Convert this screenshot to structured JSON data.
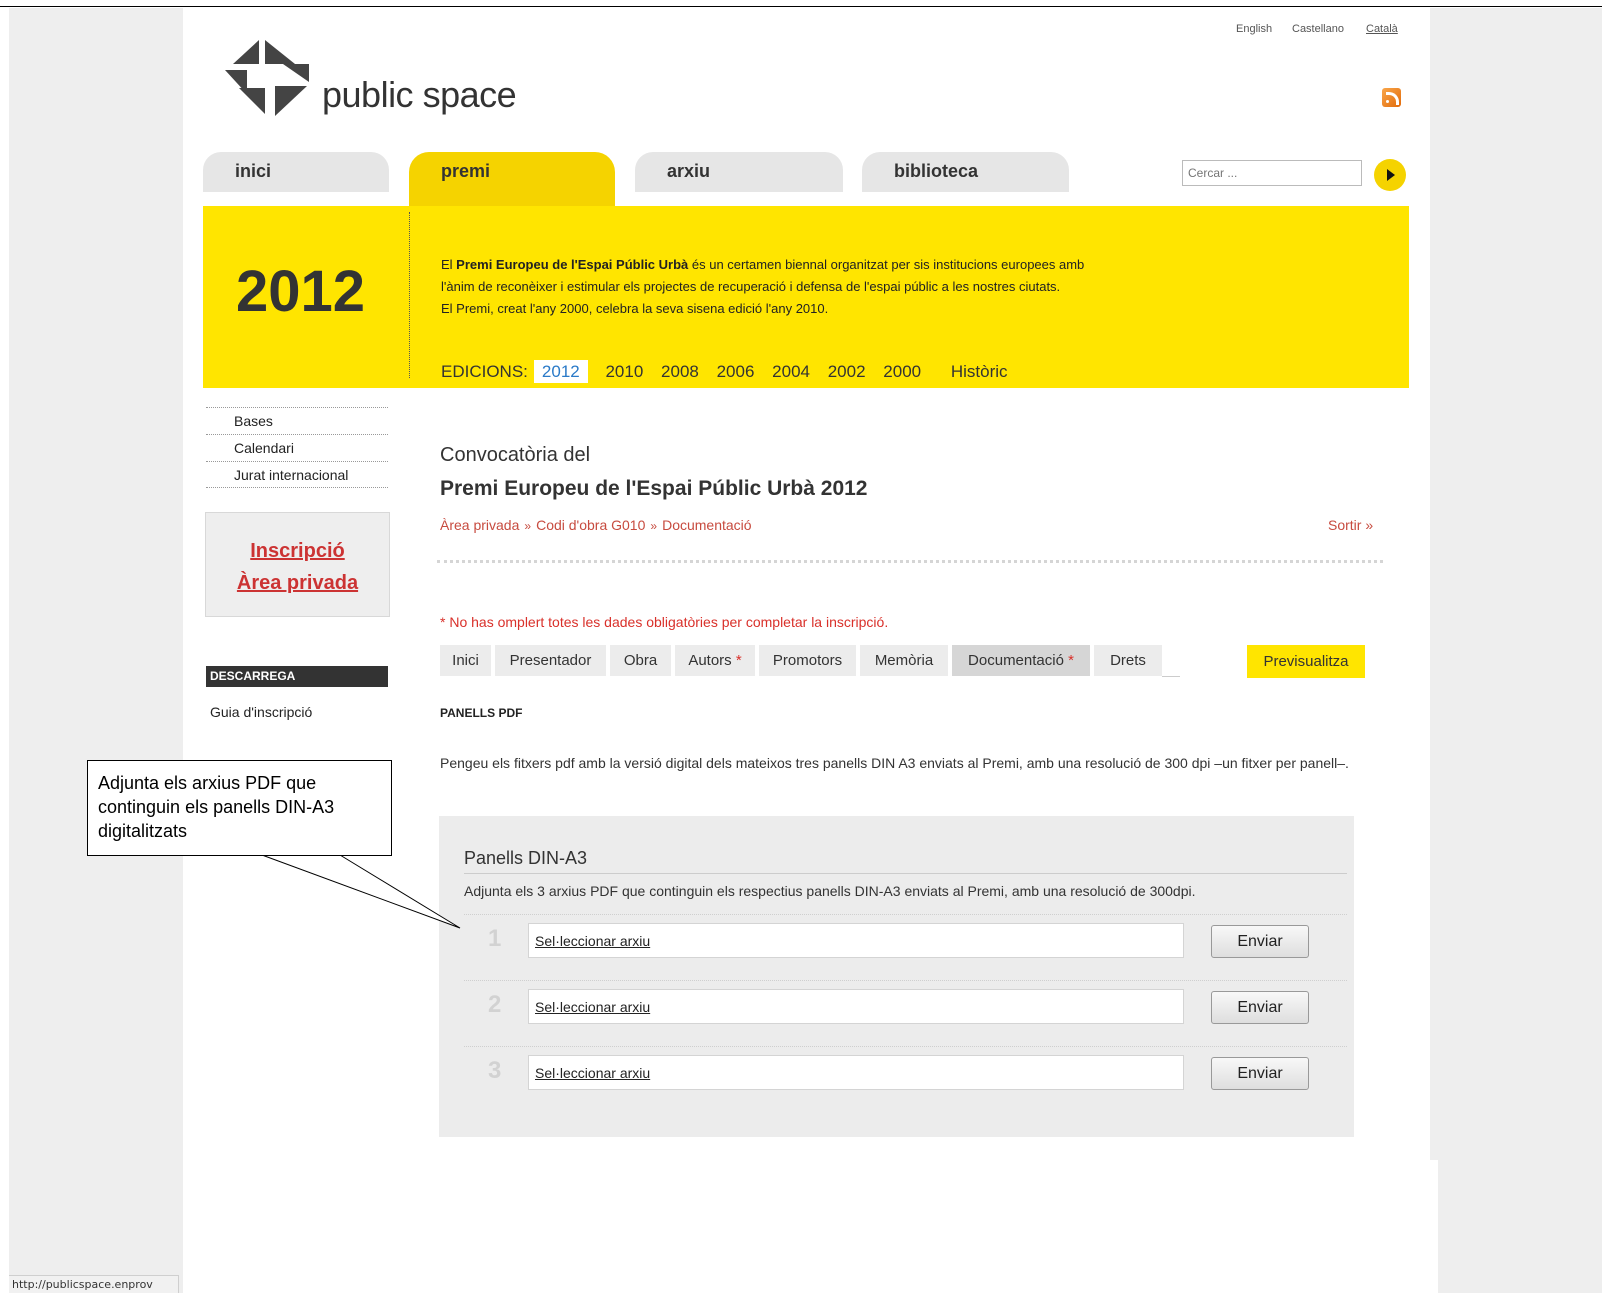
{
  "window": {
    "status_url": "http://publicspace.enprov"
  },
  "header": {
    "logo_text": "public space",
    "languages": [
      "English",
      "Castellano",
      "Català"
    ],
    "active_language": "Català",
    "rss_icon": "rss-icon"
  },
  "nav": {
    "tabs": [
      "inici",
      "premi",
      "arxiu",
      "biblioteca"
    ],
    "active_tab": "premi",
    "search_placeholder": "Cercar ..."
  },
  "banner": {
    "year": "2012",
    "text_pre": "El ",
    "text_bold": "Premi Europeu de l'Espai Públic Urbà",
    "text_line1_rest": " és un certamen biennal organitzat per sis institucions europees amb",
    "text_line2": "l'ànim de reconèixer i estimular els projectes de recuperació i defensa de l'espai públic a les nostres ciutats.",
    "text_line3": "El Premi, creat l'any 2000, celebra la seva sisena edició l'any 2010.",
    "editions_label": "EDICIONS:",
    "editions": [
      "2012",
      "2010",
      "2008",
      "2006",
      "2004",
      "2002",
      "2000"
    ],
    "active_edition": "2012",
    "historic": "Històric"
  },
  "left_menu": {
    "items": [
      "Bases",
      "Calendari",
      "Jurat internacional"
    ],
    "registration_link": "Inscripció",
    "private_area_link": "Àrea privada",
    "download_title": "DESCARREGA",
    "download_link": "Guia d'inscripció"
  },
  "main": {
    "title_line1": "Convocatòria del",
    "title_line2": "Premi Europeu de l'Espai Públic Urbà 2012",
    "breadcrumb": [
      "Àrea privada",
      "Codi d'obra G010",
      "Documentació"
    ],
    "breadcrumb_sep": "»",
    "logout": "Sortir »",
    "warning": "* No has omplert totes les dades obligatòries per completar la inscripció.",
    "tabs": [
      "Inici",
      "Presentador",
      "Obra",
      "Autors",
      "Promotors",
      "Memòria",
      "Documentació",
      "Drets"
    ],
    "required_mark": "*",
    "active_tab": "Documentació",
    "preview_button": "Previsualitza",
    "section_title": "PANELLS PDF",
    "section_desc": "Pengeu els fitxers pdf amb la versió digital dels mateixos tres panells DIN A3 enviats al Premi, amb una resolució de 300 dpi –un fitxer per panell–."
  },
  "panel": {
    "title": "Panells DIN-A3",
    "description": "Adjunta els 3 arxius PDF que continguin els respectius panells DIN-A3 enviats al Premi, amb una resolució de 300dpi.",
    "rows": [
      {
        "num": "1",
        "file_label": "Sel·leccionar arxiu",
        "button": "Enviar"
      },
      {
        "num": "2",
        "file_label": "Sel·leccionar arxiu",
        "button": "Enviar"
      },
      {
        "num": "3",
        "file_label": "Sel·leccionar arxiu",
        "button": "Enviar"
      }
    ]
  },
  "callout": {
    "text": "Adjunta  els arxius PDF que continguin els panells DIN-A3 digitalitzats"
  },
  "colors": {
    "brand_yellow": "#ffe500",
    "nav_yellow": "#f5d300",
    "link_red": "#c74b3f",
    "edition_blue": "#2a7ac8"
  }
}
